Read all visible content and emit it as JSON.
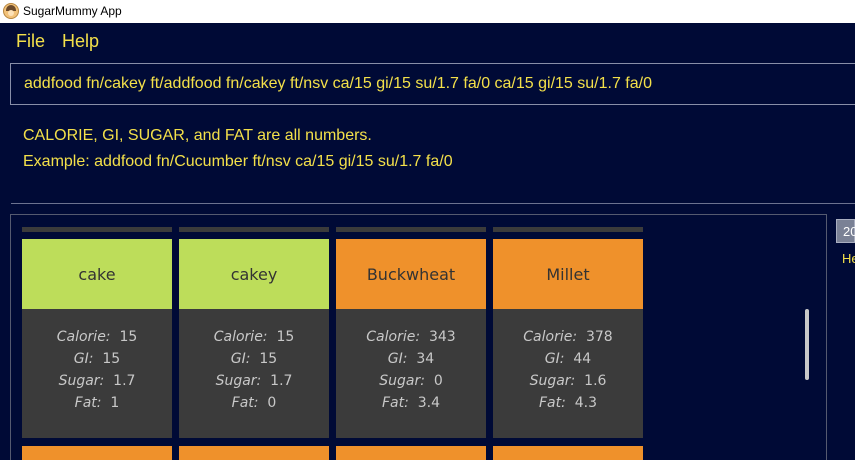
{
  "app": {
    "title": "SugarMummy App"
  },
  "menu": {
    "file": "File",
    "help": "Help"
  },
  "command": {
    "value": "addfood fn/cakey ft/addfood fn/cakey ft/nsv ca/15 gi/15 su/1.7 fa/0 ca/15 gi/15 su/1.7 fa/0"
  },
  "result": {
    "line1": "CALORIE, GI, SUGAR, and FAT are all numbers.",
    "line2": "Example: addfood fn/Cucumber ft/nsv ca/15 gi/15 su/1.7 fa/0"
  },
  "food_labels": {
    "calorie": "Calorie:",
    "gi": "GI:",
    "sugar": "Sugar:",
    "fat": "Fat:"
  },
  "foods": [
    {
      "name": "cake",
      "color": "#bddd5a",
      "calorie": "15",
      "gi": "15",
      "sugar": "1.7",
      "fat": "1"
    },
    {
      "name": "cakey",
      "color": "#bddd5a",
      "calorie": "15",
      "gi": "15",
      "sugar": "1.7",
      "fat": "0"
    },
    {
      "name": "Buckwheat",
      "color": "#ef912b",
      "calorie": "343",
      "gi": "34",
      "sugar": "0",
      "fat": "3.4"
    },
    {
      "name": "Millet",
      "color": "#ef912b",
      "calorie": "378",
      "gi": "44",
      "sugar": "1.6",
      "fat": "4.3"
    }
  ],
  "next_row_color": "#ef912b",
  "side": {
    "tab_label": "20",
    "text": "He"
  }
}
